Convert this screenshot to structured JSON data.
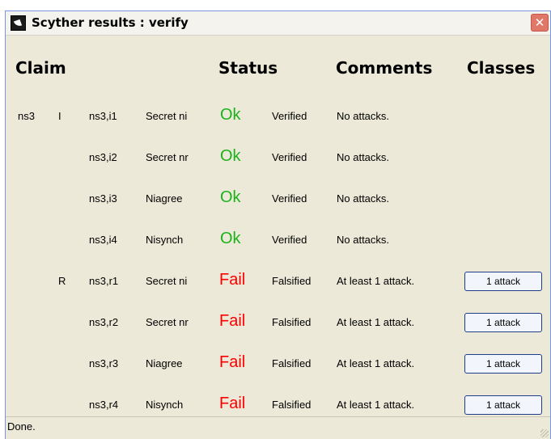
{
  "window": {
    "title": "Scyther results : verify"
  },
  "headers": {
    "claim": "Claim",
    "status": "Status",
    "comments": "Comments",
    "classes": "Classes"
  },
  "rows": [
    {
      "protocol": "ns3",
      "role": "I",
      "id": "ns3,i1",
      "claim": "Secret ni",
      "status": "Ok",
      "verdict": "Verified",
      "comment": "No attacks.",
      "classes": ""
    },
    {
      "protocol": "",
      "role": "",
      "id": "ns3,i2",
      "claim": "Secret nr",
      "status": "Ok",
      "verdict": "Verified",
      "comment": "No attacks.",
      "classes": ""
    },
    {
      "protocol": "",
      "role": "",
      "id": "ns3,i3",
      "claim": "Niagree",
      "status": "Ok",
      "verdict": "Verified",
      "comment": "No attacks.",
      "classes": ""
    },
    {
      "protocol": "",
      "role": "",
      "id": "ns3,i4",
      "claim": "Nisynch",
      "status": "Ok",
      "verdict": "Verified",
      "comment": "No attacks.",
      "classes": ""
    },
    {
      "protocol": "",
      "role": "R",
      "id": "ns3,r1",
      "claim": "Secret ni",
      "status": "Fail",
      "verdict": "Falsified",
      "comment": "At least 1 attack.",
      "classes": "1 attack"
    },
    {
      "protocol": "",
      "role": "",
      "id": "ns3,r2",
      "claim": "Secret nr",
      "status": "Fail",
      "verdict": "Falsified",
      "comment": "At least 1 attack.",
      "classes": "1 attack"
    },
    {
      "protocol": "",
      "role": "",
      "id": "ns3,r3",
      "claim": "Niagree",
      "status": "Fail",
      "verdict": "Falsified",
      "comment": "At least 1 attack.",
      "classes": "1 attack"
    },
    {
      "protocol": "",
      "role": "",
      "id": "ns3,r4",
      "claim": "Nisynch",
      "status": "Fail",
      "verdict": "Falsified",
      "comment": "At least 1 attack.",
      "classes": "1 attack"
    }
  ],
  "statusbar": {
    "text": "Done."
  },
  "colors": {
    "ok": "#1cb21c",
    "fail": "#ff0000",
    "window_bg": "#ece9d8"
  },
  "icons": {
    "app": "scyther-app-icon",
    "close": "close-icon",
    "grip": "resize-grip-icon"
  }
}
